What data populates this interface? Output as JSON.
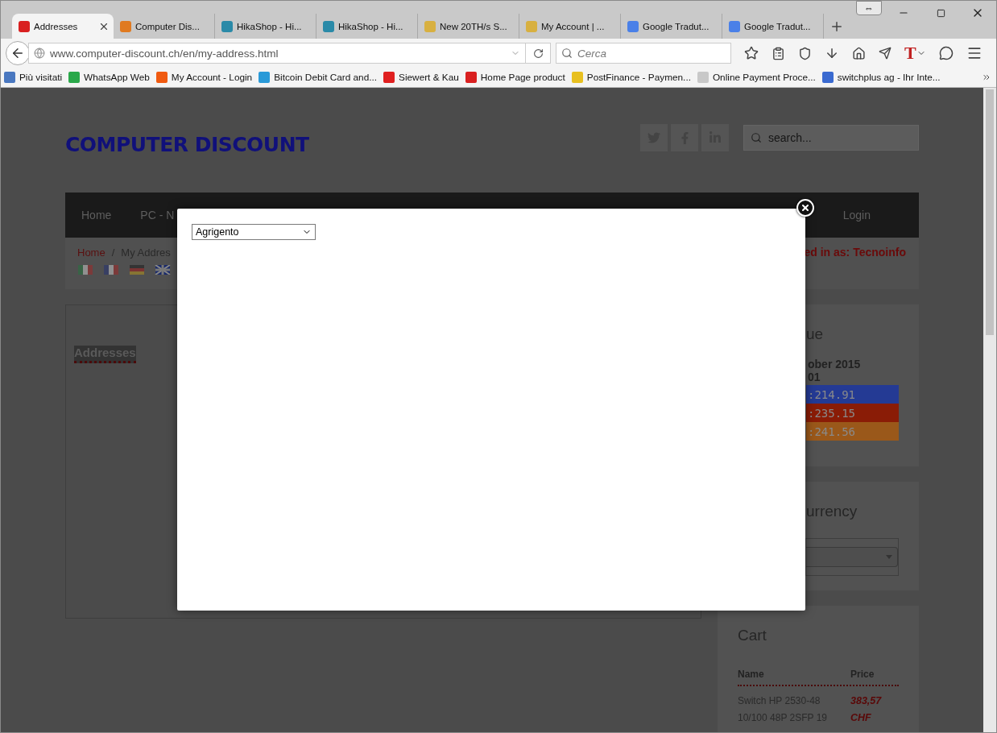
{
  "browser": {
    "tabs": [
      {
        "label": "Addresses",
        "selected": true
      },
      {
        "label": "Computer Dis...",
        "selected": false
      },
      {
        "label": "HikaShop - Hi...",
        "selected": false
      },
      {
        "label": "HikaShop - Hi...",
        "selected": false
      },
      {
        "label": "New 20TH/s S...",
        "selected": false
      },
      {
        "label": "My Account | ...",
        "selected": false
      },
      {
        "label": "Google Tradut...",
        "selected": false
      },
      {
        "label": "Google Tradut...",
        "selected": false
      }
    ],
    "resize_glyph": "⇔",
    "text_tool": "T",
    "url": "www.computer-discount.ch/en/my-address.html",
    "search": {
      "placeholder": "Cerca"
    },
    "bookmarks": [
      {
        "label": "Più visitati",
        "color": "#4a78c0"
      },
      {
        "label": "WhatsApp Web",
        "color": "#2aa84a"
      },
      {
        "label": "My Account - Login",
        "color": "#f05a10"
      },
      {
        "label": "Bitcoin Debit Card and...",
        "color": "#2a9ad8"
      },
      {
        "label": "Siewert & Kau",
        "color": "#e02020"
      },
      {
        "label": "Home Page product",
        "color": "#d92020"
      },
      {
        "label": "PostFinance - Paymen...",
        "color": "#e8c020"
      },
      {
        "label": "Online Payment Proce...",
        "color": "#c8c8c8"
      },
      {
        "label": "switchplus ag - Ihr Inte...",
        "color": "#3a6ad0"
      }
    ]
  },
  "site": {
    "logo": "COMPUTER DISCOUNT",
    "search": {
      "placeholder": "search..."
    },
    "nav": [
      "Home",
      "PC - N",
      "Login"
    ],
    "breadcrumb": [
      "Home",
      "/",
      "My Addres"
    ],
    "logged_in": "ed in as: Tecnoinfo",
    "section_title": "Addresses",
    "value_panel": {
      "title": "ue",
      "date": "ober 2015",
      "line": "01",
      "rates": [
        {
          "text": ":214.91",
          "color": "#243a94"
        },
        {
          "text": ":235.15",
          "color": "#8a1c06"
        },
        {
          "text": ":241.56",
          "color": "#9a581a"
        }
      ]
    },
    "currency_panel": {
      "title": "urrency"
    },
    "cart": {
      "title": "Cart",
      "columns": [
        "Name",
        "Price"
      ],
      "rows": [
        {
          "name": "Switch HP 2530-48 10/100 48P 2SFP 19",
          "price": "383,57 CHF"
        }
      ]
    }
  },
  "modal": {
    "select": {
      "value": "Agrigento"
    }
  }
}
